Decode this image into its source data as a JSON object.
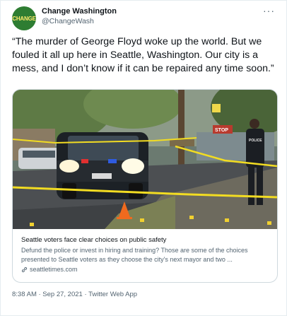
{
  "tweet": {
    "author": {
      "display_name": "Change Washington",
      "handle": "@ChangeWash",
      "avatar_text": "CHANGE",
      "avatar_color": "#2e7d32"
    },
    "more_icon": "more-horizontal-icon",
    "text": "“The murder of George Floyd woke up the world. But we fouled it all up here in Seattle, Washington. Our city is a mess, and I don’t know if it can be repaired any time soon.”",
    "card": {
      "image": {
        "sign_text": "STOP",
        "vest_text": "POLICE"
      },
      "title": "Seattle voters face clear choices on public safety",
      "description": "Defund the police or invest in hiring and training? Those are some of the choices presented to Seattle voters as they choose the city's next mayor and two ...",
      "domain": "seattletimes.com",
      "link_icon": "link-icon"
    },
    "meta": "8:38 AM · Sep 27, 2021 · Twitter Web App"
  }
}
